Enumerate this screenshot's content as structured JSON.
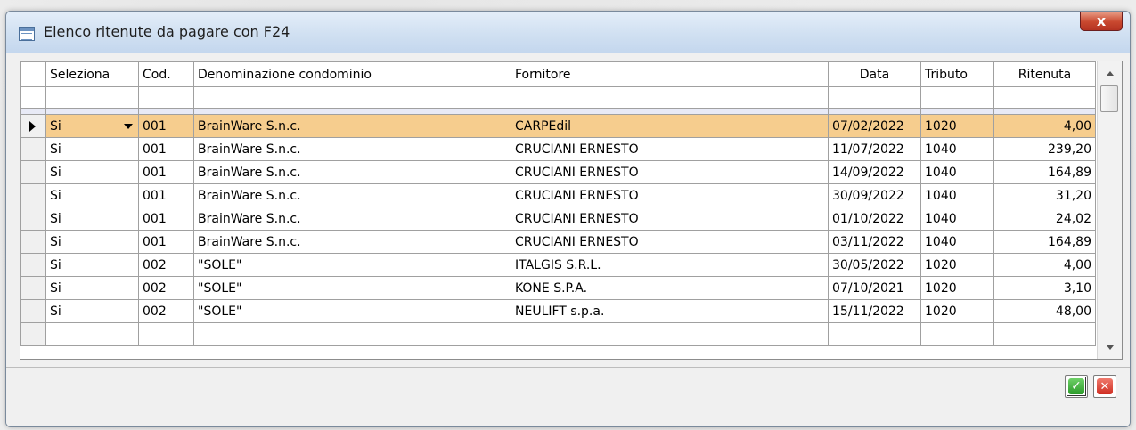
{
  "window": {
    "title": "Elenco ritenute da pagare con F24",
    "close_label": "x"
  },
  "grid": {
    "columns": [
      "Seleziona",
      "Cod.",
      "Denominazione condominio",
      "Fornitore",
      "Data",
      "Tributo",
      "Ritenuta"
    ],
    "rows": [
      {
        "seleziona": "Si",
        "cod": "001",
        "condominio": "BrainWare S.n.c.",
        "fornitore": "CARPEdil",
        "data": "07/02/2022",
        "tributo": "1020",
        "ritenuta": "4,00",
        "selected": true
      },
      {
        "seleziona": "Si",
        "cod": "001",
        "condominio": "BrainWare S.n.c.",
        "fornitore": "CRUCIANI ERNESTO",
        "data": "11/07/2022",
        "tributo": "1040",
        "ritenuta": "239,20"
      },
      {
        "seleziona": "Si",
        "cod": "001",
        "condominio": "BrainWare S.n.c.",
        "fornitore": "CRUCIANI ERNESTO",
        "data": "14/09/2022",
        "tributo": "1040",
        "ritenuta": "164,89"
      },
      {
        "seleziona": "Si",
        "cod": "001",
        "condominio": "BrainWare S.n.c.",
        "fornitore": "CRUCIANI ERNESTO",
        "data": "30/09/2022",
        "tributo": "1040",
        "ritenuta": "31,20"
      },
      {
        "seleziona": "Si",
        "cod": "001",
        "condominio": "BrainWare S.n.c.",
        "fornitore": "CRUCIANI ERNESTO",
        "data": "01/10/2022",
        "tributo": "1040",
        "ritenuta": "24,02"
      },
      {
        "seleziona": "Si",
        "cod": "001",
        "condominio": "BrainWare S.n.c.",
        "fornitore": "CRUCIANI ERNESTO",
        "data": "03/11/2022",
        "tributo": "1040",
        "ritenuta": "164,89"
      },
      {
        "seleziona": "Si",
        "cod": "002",
        "condominio": "\"SOLE\"",
        "fornitore": "ITALGIS S.R.L.",
        "data": "30/05/2022",
        "tributo": "1020",
        "ritenuta": "4,00"
      },
      {
        "seleziona": "Si",
        "cod": "002",
        "condominio": "\"SOLE\"",
        "fornitore": "KONE S.P.A.",
        "data": "07/10/2021",
        "tributo": "1020",
        "ritenuta": "3,10"
      },
      {
        "seleziona": "Si",
        "cod": "002",
        "condominio": "\"SOLE\"",
        "fornitore": "NEULIFT s.p.a.",
        "data": "15/11/2022",
        "tributo": "1020",
        "ritenuta": "48,00"
      }
    ]
  },
  "buttons": {
    "ok_icon": "check-icon",
    "cancel_icon": "x-icon",
    "ok_glyph": "✓",
    "cancel_glyph": "✕"
  }
}
